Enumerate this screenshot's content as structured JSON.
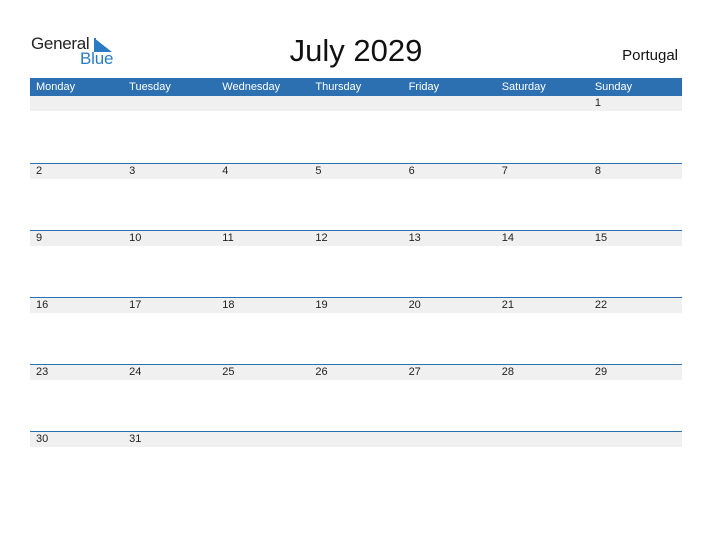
{
  "logo": {
    "line1": "General",
    "line2": "Blue"
  },
  "title": "July 2029",
  "country": "Portugal",
  "weekdays": [
    "Monday",
    "Tuesday",
    "Wednesday",
    "Thursday",
    "Friday",
    "Saturday",
    "Sunday"
  ],
  "weeks": [
    [
      "",
      "",
      "",
      "",
      "",
      "",
      "1"
    ],
    [
      "2",
      "3",
      "4",
      "5",
      "6",
      "7",
      "8"
    ],
    [
      "9",
      "10",
      "11",
      "12",
      "13",
      "14",
      "15"
    ],
    [
      "16",
      "17",
      "18",
      "19",
      "20",
      "21",
      "22"
    ],
    [
      "23",
      "24",
      "25",
      "26",
      "27",
      "28",
      "29"
    ],
    [
      "30",
      "31",
      "",
      "",
      "",
      "",
      ""
    ]
  ],
  "colors": {
    "accent": "#2c70b1",
    "logo_blue": "#2a7bc4",
    "day_band": "#f0f0f0"
  }
}
